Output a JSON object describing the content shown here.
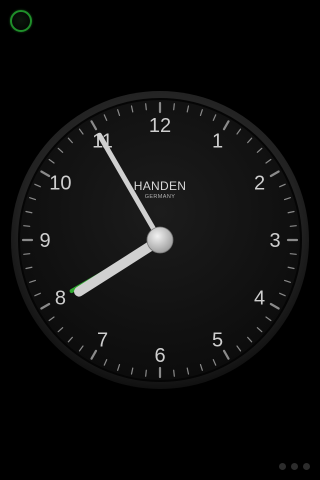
{
  "status": {
    "indicator_icon": "alarm-ring-icon",
    "indicator_color": "#1f8f2a"
  },
  "clock": {
    "brand": "HANDEN",
    "origin": "GERMANY",
    "numerals": [
      "12",
      "1",
      "2",
      "3",
      "4",
      "5",
      "6",
      "7",
      "8",
      "9",
      "10",
      "11"
    ],
    "time": {
      "hour": 7,
      "minute": 55
    },
    "alarm": {
      "hour": 8,
      "minute": 0
    },
    "colors": {
      "face": "#151515",
      "bezel": "#2a2a2a",
      "numerals": "#cfcfcf",
      "hands": "#d0d0d0",
      "alarm_hand": "#2fa82f"
    }
  },
  "pager": {
    "dots": [
      "page-1",
      "page-2",
      "page-3"
    ]
  }
}
